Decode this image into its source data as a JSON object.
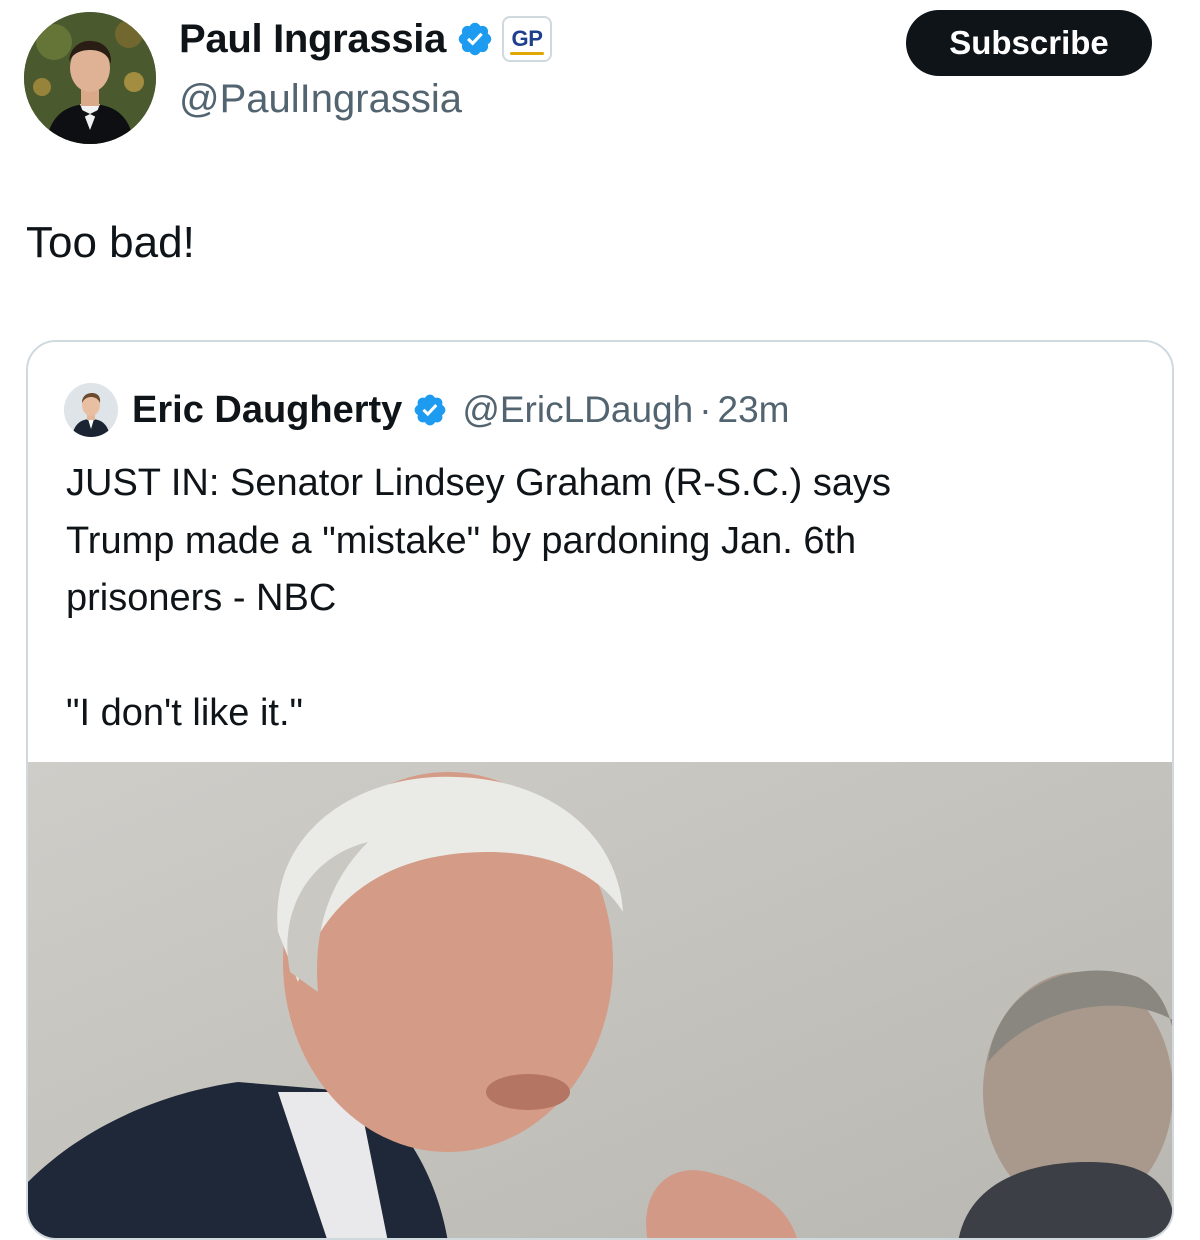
{
  "post": {
    "author": {
      "name": "Paul Ingrassia",
      "handle": "@PaulIngrassia",
      "affiliate_badge": "GP",
      "verified_color": "#1d9bf0"
    },
    "subscribe_label": "Subscribe",
    "text": "Too bad!"
  },
  "quoted": {
    "author": {
      "name": "Eric Daugherty",
      "handle": "@EricLDaugh"
    },
    "separator": "·",
    "time": "23m",
    "text_lines": [
      "JUST IN: Senator Lindsey Graham (R-S.C.) says",
      "Trump made a \"mistake\" by pardoning Jan. 6th",
      "prisoners - NBC"
    ],
    "quote_line": "\"I don't like it.\"",
    "image": {
      "alt": ""
    }
  },
  "colors": {
    "text_primary": "#0f1419",
    "text_secondary": "#536471",
    "border": "#cfd9de",
    "button_bg": "#0f1419",
    "verified": "#1d9bf0",
    "gp_gold": "#e0a800",
    "gp_blue": "#1d3f8c"
  }
}
